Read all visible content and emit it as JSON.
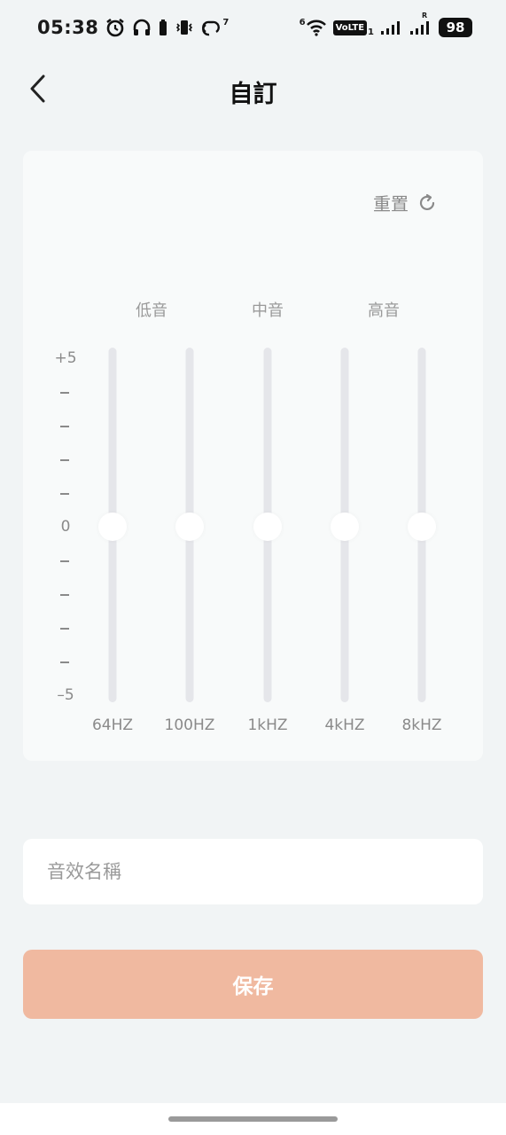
{
  "status_bar": {
    "time": "05:38",
    "icons_left": [
      "alarm-icon",
      "headphones-icon",
      "vibrate-icon",
      "hotspot-icon"
    ],
    "hotspot_superscript": "7",
    "wifi_superscript": "6",
    "volte": "VoLTE",
    "volte_sub": "1",
    "roaming": "R",
    "battery": "98"
  },
  "header": {
    "title": "自訂",
    "back_icon": "chevron-left-icon"
  },
  "equalizer": {
    "reset_label": "重置",
    "reset_icon": "refresh-icon",
    "band_groups": [
      "低音",
      "中音",
      "高音"
    ],
    "scale": [
      "+5",
      "–",
      "–",
      "–",
      "–",
      "0",
      "–",
      "–",
      "–",
      "–",
      "–5"
    ],
    "bands": [
      {
        "freq": "64HZ",
        "value": 0
      },
      {
        "freq": "100HZ",
        "value": 0
      },
      {
        "freq": "1kHZ",
        "value": 0
      },
      {
        "freq": "4kHZ",
        "value": 0
      },
      {
        "freq": "8kHZ",
        "value": 0
      }
    ],
    "range": [
      -5,
      5
    ],
    "track_color": "#e5e6ea",
    "thumb_color": "#ffffff"
  },
  "name_field": {
    "placeholder": "音效名稱",
    "value": ""
  },
  "save_button": {
    "label": "保存",
    "color": "#f0b9a0"
  }
}
